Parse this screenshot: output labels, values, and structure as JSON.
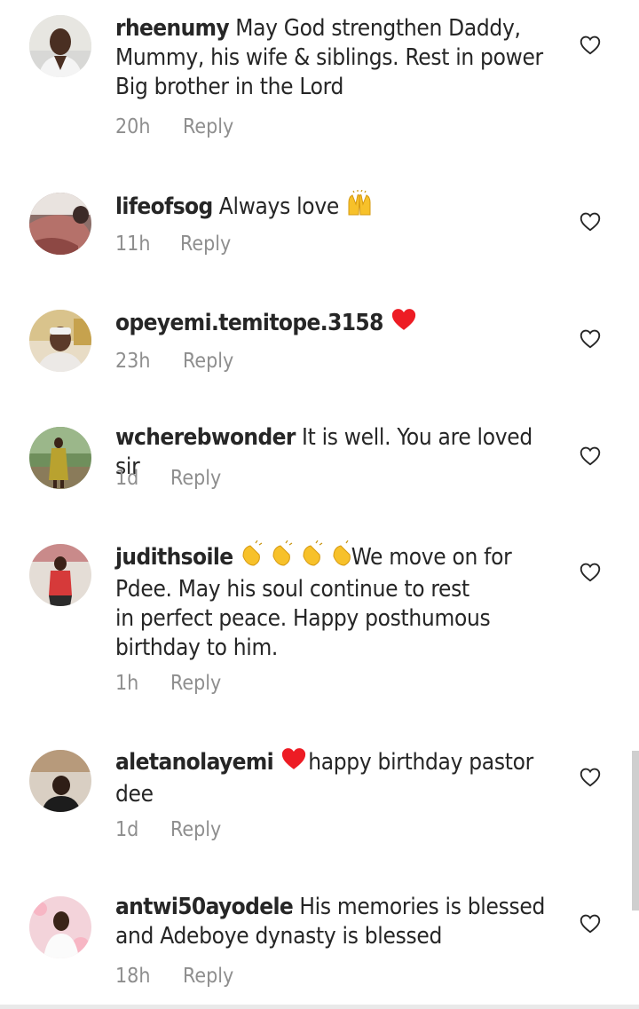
{
  "comments": [
    {
      "username": "rheenumy",
      "text": "May God strengthen Daddy,",
      "text2": "Mummy, his wife & siblings. Rest in power",
      "text3": "Big brother in the Lord",
      "time": "20h",
      "reply": "Reply"
    },
    {
      "username": "lifeofsog",
      "text": "Always love",
      "time": "11h",
      "reply": "Reply"
    },
    {
      "username": "opeyemi.temitope.3158",
      "time": "23h",
      "reply": "Reply"
    },
    {
      "username": "wcherebwonder",
      "text": "It is well. You are loved sir",
      "time": "1d",
      "reply": "Reply"
    },
    {
      "username": "judithsoile",
      "text": "We move on for",
      "text2": "Pdee.  May his soul continue to rest",
      "text3": "in perfect peace.  Happy posthumous",
      "text4": "birthday to him.",
      "time": "1h",
      "reply": "Reply"
    },
    {
      "username": "aletanolayemi",
      "text": "happy birthday pastor",
      "text2": "dee",
      "time": "1d",
      "reply": "Reply"
    },
    {
      "username": "antwi50ayodele",
      "text": "His memories is blessed",
      "text2": "and Adeboye dynasty is blessed",
      "time": "18h",
      "reply": "Reply"
    }
  ],
  "icons": {
    "like": "heart-outline-icon",
    "heart_emoji": "red-heart-emoji",
    "raising_hands": "raising-hands-emoji",
    "clapping": "clapping-hands-emoji"
  },
  "colors": {
    "text": "#262626",
    "meta": "#8e8e8e",
    "heart": "#ed1c24"
  }
}
